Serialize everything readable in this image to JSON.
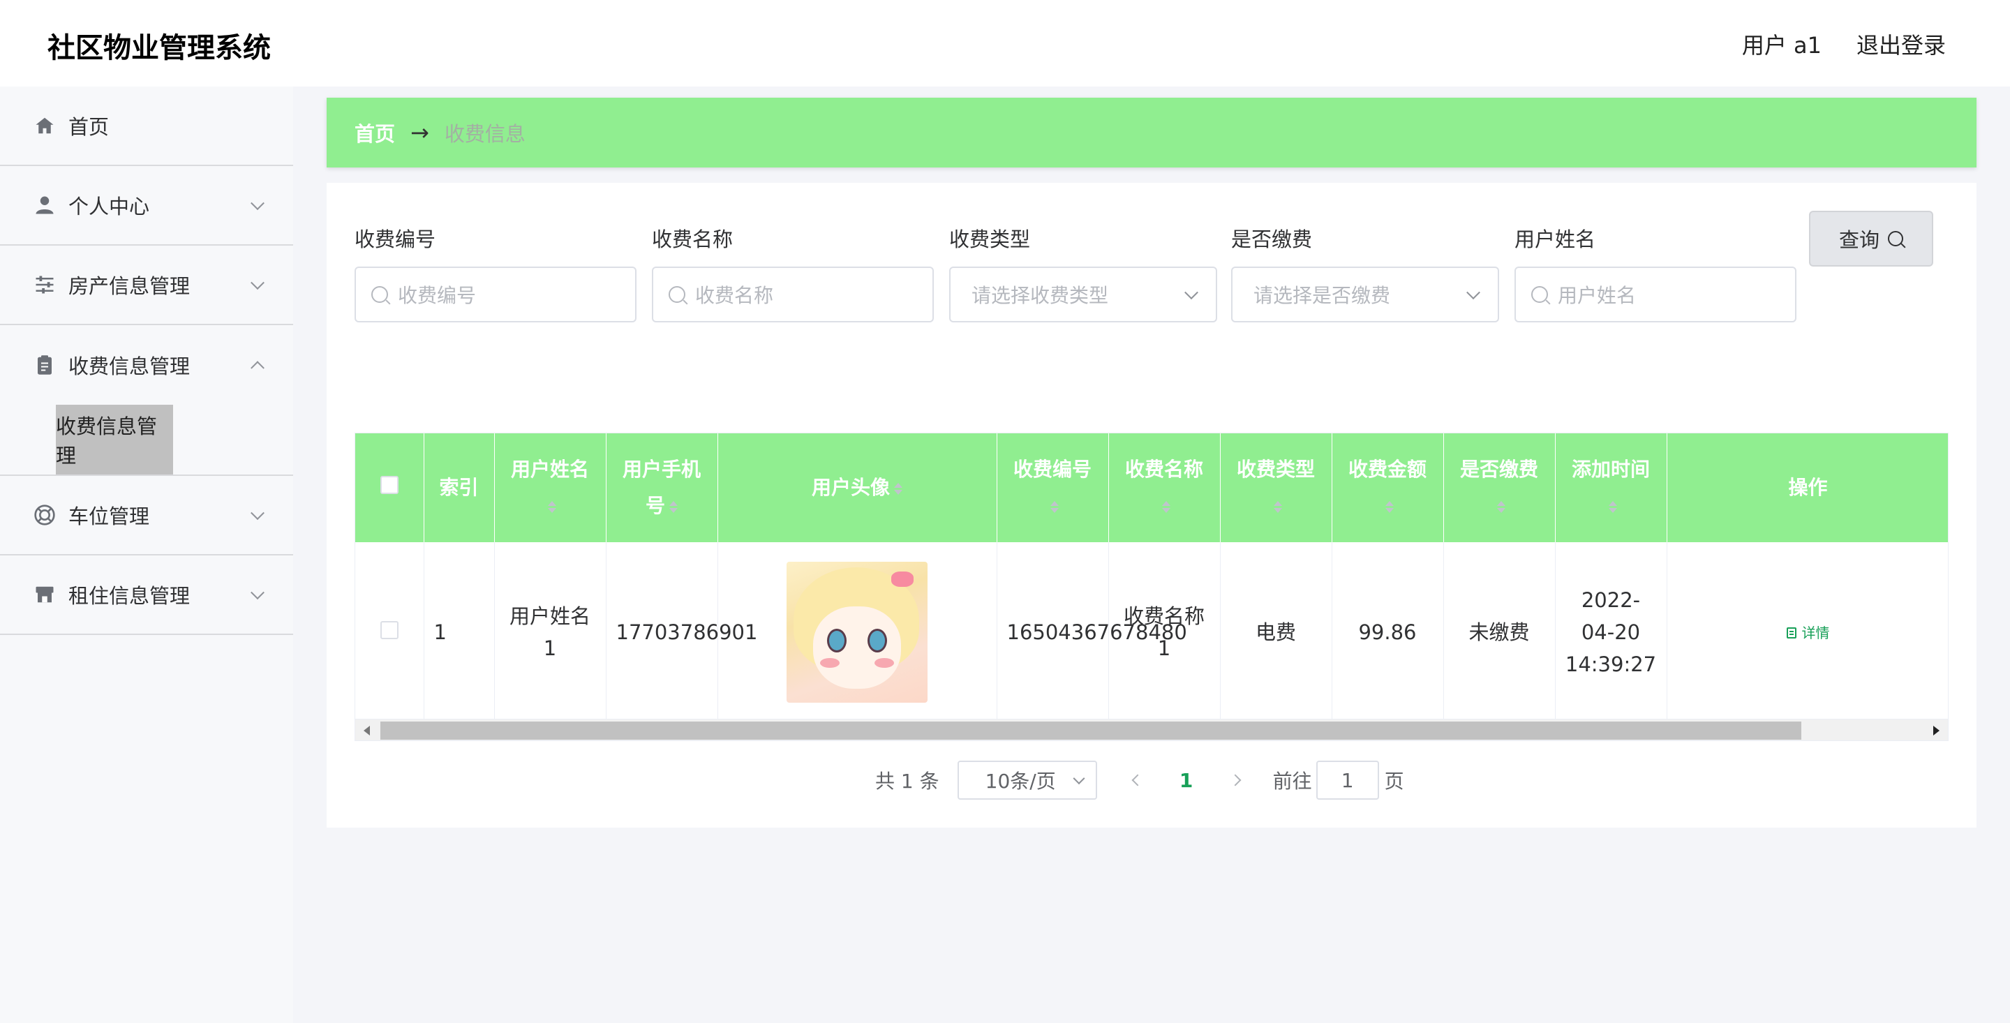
{
  "header": {
    "title": "社区物业管理系统",
    "user": "用户 a1",
    "logout": "退出登录"
  },
  "sidebar": {
    "items": [
      {
        "label": "首页",
        "icon": "home-icon"
      },
      {
        "label": "个人中心",
        "icon": "user-icon"
      },
      {
        "label": "房产信息管理",
        "icon": "sliders-icon"
      },
      {
        "label": "收费信息管理",
        "icon": "clipboard-icon",
        "expanded": true,
        "children": [
          {
            "label": "收费信息管理"
          }
        ]
      },
      {
        "label": "车位管理",
        "icon": "lifebuoy-icon"
      },
      {
        "label": "租住信息管理",
        "icon": "shop-icon"
      }
    ]
  },
  "breadcrumb": {
    "home": "首页",
    "arrow": "→",
    "current": "收费信息"
  },
  "search": {
    "fields": [
      {
        "label": "收费编号",
        "placeholder": "收费编号",
        "type": "input"
      },
      {
        "label": "收费名称",
        "placeholder": "收费名称",
        "type": "input"
      },
      {
        "label": "收费类型",
        "placeholder": "请选择收费类型",
        "type": "select"
      },
      {
        "label": "是否缴费",
        "placeholder": "请选择是否缴费",
        "type": "select"
      },
      {
        "label": "用户姓名",
        "placeholder": "用户姓名",
        "type": "input"
      }
    ],
    "query_label": "查询"
  },
  "table": {
    "headers": [
      "索引",
      "用户姓名",
      "用户手机号",
      "用户头像",
      "收费编号",
      "收费名称",
      "收费类型",
      "收费金额",
      "是否缴费",
      "添加时间",
      "操作"
    ],
    "rows": [
      {
        "index": "1",
        "user_name": "用户姓名1",
        "phone": "17703786901",
        "avatar": "anime-girl-avatar",
        "fee_no": "16504367678480",
        "fee_name": "收费名称1",
        "fee_type": "电费",
        "amount": "99.86",
        "paid": "未缴费",
        "time": "2022-04-20 14:39:27",
        "action": "详情"
      }
    ]
  },
  "pagination": {
    "total": "共 1 条",
    "page_size": "10条/页",
    "current": "1",
    "goto_label": "前往",
    "goto_value": "1",
    "page_suffix": "页"
  },
  "colors": {
    "accent_green": "#90ee90",
    "link_green": "#18a058"
  }
}
